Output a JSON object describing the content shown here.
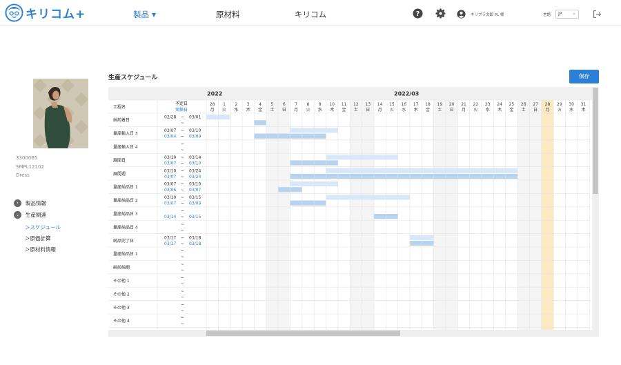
{
  "header": {
    "logo_text": "キリコム+",
    "nav": [
      {
        "label": "製品",
        "active": true
      },
      {
        "label": "原材料",
        "active": false
      },
      {
        "label": "キリコム",
        "active": false
      }
    ],
    "username": "キリプラ太郎 PL 様",
    "language_label": "言語",
    "language_value": "JP"
  },
  "product": {
    "code": "3300065",
    "sku": "SMPL12102",
    "type": "Dress"
  },
  "sidebar": {
    "sections": [
      {
        "label": "製品情報",
        "expanded": false
      },
      {
        "label": "生産関連",
        "expanded": true
      }
    ],
    "subitems": [
      {
        "label": "＞スケジュール",
        "active": true
      },
      {
        "label": "＞原価計算",
        "active": false
      },
      {
        "label": "＞原材料情報",
        "active": false
      }
    ]
  },
  "page": {
    "title": "生産スケジュール",
    "save_label": "保存"
  },
  "schedule": {
    "year_label": "2022",
    "month_label": "2022/03",
    "process_header": "工程名",
    "planned_header": "予定日",
    "actual_header": "実績日",
    "colors": {
      "planned": "#d9e8f8",
      "actual": "#b7d3ee",
      "today": "#fbe9c2",
      "weekend": "#f5f5f5",
      "actual_text": "#2b7fd4"
    },
    "today_index": 28,
    "days": [
      {
        "d": "28",
        "w": "月"
      },
      {
        "d": "1",
        "w": "火"
      },
      {
        "d": "2",
        "w": "水"
      },
      {
        "d": "3",
        "w": "木"
      },
      {
        "d": "4",
        "w": "金"
      },
      {
        "d": "5",
        "w": "土"
      },
      {
        "d": "6",
        "w": "日"
      },
      {
        "d": "7",
        "w": "月"
      },
      {
        "d": "8",
        "w": "火"
      },
      {
        "d": "9",
        "w": "水"
      },
      {
        "d": "10",
        "w": "木"
      },
      {
        "d": "11",
        "w": "金"
      },
      {
        "d": "12",
        "w": "土"
      },
      {
        "d": "13",
        "w": "日"
      },
      {
        "d": "14",
        "w": "月"
      },
      {
        "d": "15",
        "w": "火"
      },
      {
        "d": "16",
        "w": "水"
      },
      {
        "d": "17",
        "w": "木"
      },
      {
        "d": "18",
        "w": "金"
      },
      {
        "d": "19",
        "w": "土"
      },
      {
        "d": "20",
        "w": "日"
      },
      {
        "d": "21",
        "w": "月"
      },
      {
        "d": "22",
        "w": "火"
      },
      {
        "d": "23",
        "w": "水"
      },
      {
        "d": "24",
        "w": "木"
      },
      {
        "d": "25",
        "w": "金"
      },
      {
        "d": "26",
        "w": "土"
      },
      {
        "d": "27",
        "w": "日"
      },
      {
        "d": "28",
        "w": "月"
      },
      {
        "d": "29",
        "w": "火"
      },
      {
        "d": "30",
        "w": "水"
      },
      {
        "d": "31",
        "w": "木"
      }
    ],
    "rows": [
      {
        "name": "納前着日",
        "plan": [
          "02/28",
          "03/01"
        ],
        "actual": [
          "",
          ""
        ],
        "plan_bar": [
          0,
          1
        ],
        "actual_bar": [
          4,
          4
        ]
      },
      {
        "name": "量産輸入日 3",
        "plan": [
          "03/07",
          "03/10"
        ],
        "actual": [
          "03/04",
          "03/09"
        ],
        "plan_bar": [
          7,
          10
        ],
        "actual_bar": [
          4,
          9
        ]
      },
      {
        "name": "量産輸入日 4",
        "plan": [
          "",
          ""
        ],
        "actual": [
          "",
          ""
        ],
        "plan_bar": null,
        "actual_bar": null
      },
      {
        "name": "展開日",
        "plan": [
          "03/10",
          "03/14"
        ],
        "actual": [
          "03/07",
          "03/10"
        ],
        "plan_bar": [
          10,
          15
        ],
        "actual_bar": [
          7,
          10
        ]
      },
      {
        "name": "展開週",
        "plan": [
          "03/10",
          "03/24"
        ],
        "actual": [
          "03/07",
          "03/24"
        ],
        "plan_bar": [
          10,
          25
        ],
        "actual_bar": [
          7,
          25
        ]
      },
      {
        "name": "量産納品日 1",
        "plan": [
          "03/07",
          "03/10"
        ],
        "actual": [
          "03/06",
          "03/07"
        ],
        "plan_bar": [
          7,
          10
        ],
        "actual_bar": [
          6,
          7
        ]
      },
      {
        "name": "量産納品日 2",
        "plan": [
          "03/10",
          "03/15"
        ],
        "actual": [
          "03/07",
          "03/09"
        ],
        "plan_bar": [
          10,
          16
        ],
        "actual_bar": [
          7,
          9
        ]
      },
      {
        "name": "量産納品日 3",
        "plan": [
          "",
          ""
        ],
        "actual": [
          "03/14",
          "03/15"
        ],
        "plan_bar": null,
        "actual_bar": [
          14,
          15
        ]
      },
      {
        "name": "量産納品日 4",
        "plan": [
          "",
          ""
        ],
        "actual": [
          "",
          ""
        ],
        "plan_bar": null,
        "actual_bar": null
      },
      {
        "name": "納品完了日",
        "plan": [
          "03/17",
          "03/18"
        ],
        "actual": [
          "03/17",
          "03/18"
        ],
        "plan_bar": [
          17,
          18
        ],
        "actual_bar": [
          17,
          18
        ]
      },
      {
        "name": "量産納品日 1",
        "plan": [
          "",
          ""
        ],
        "actual": [
          "",
          ""
        ],
        "plan_bar": null,
        "actual_bar": null
      },
      {
        "name": "納前納期",
        "plan": [
          "",
          ""
        ],
        "actual": [
          "",
          ""
        ],
        "plan_bar": null,
        "actual_bar": null
      },
      {
        "name": "その他 1",
        "plan": [
          "",
          ""
        ],
        "actual": [
          "",
          ""
        ],
        "plan_bar": null,
        "actual_bar": null
      },
      {
        "name": "その他 2",
        "plan": [
          "",
          ""
        ],
        "actual": [
          "",
          ""
        ],
        "plan_bar": null,
        "actual_bar": null
      },
      {
        "name": "その他 3",
        "plan": [
          "",
          ""
        ],
        "actual": [
          "",
          ""
        ],
        "plan_bar": null,
        "actual_bar": null
      },
      {
        "name": "その他 4",
        "plan": [
          "",
          ""
        ],
        "actual": [
          "",
          ""
        ],
        "plan_bar": null,
        "actual_bar": null
      },
      {
        "name": "",
        "plan": [
          "",
          ""
        ],
        "actual": [
          "",
          ""
        ],
        "plan_bar": null,
        "actual_bar": null
      }
    ]
  }
}
